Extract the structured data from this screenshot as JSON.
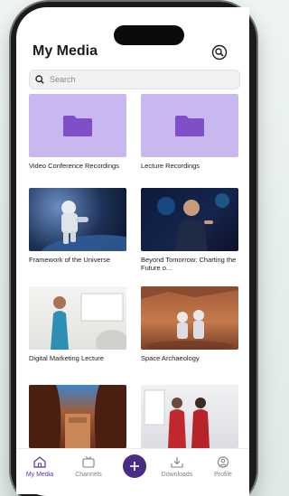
{
  "header": {
    "title": "My Media"
  },
  "search": {
    "placeholder": "Search"
  },
  "media": [
    {
      "title": "Video Conference Recordings",
      "type": "folder"
    },
    {
      "title": "Lecture Recordings",
      "type": "folder"
    },
    {
      "title": "Framework of the Universe",
      "type": "video"
    },
    {
      "title": "Beyond Tomorrow: Charting the Future o...",
      "type": "video"
    },
    {
      "title": "Digital Marketing Lecture",
      "type": "video"
    },
    {
      "title": "Space Archaeology",
      "type": "video"
    },
    {
      "title": "",
      "type": "video"
    },
    {
      "title": "",
      "type": "video"
    }
  ],
  "tabbar": {
    "my_media": "My Media",
    "channels": "Channels",
    "downloads": "Downloads",
    "profile": "Profile"
  },
  "colors": {
    "accent": "#4a2d82",
    "folder_bg": "#c9b7ef",
    "folder_icon": "#7e4fc7"
  }
}
